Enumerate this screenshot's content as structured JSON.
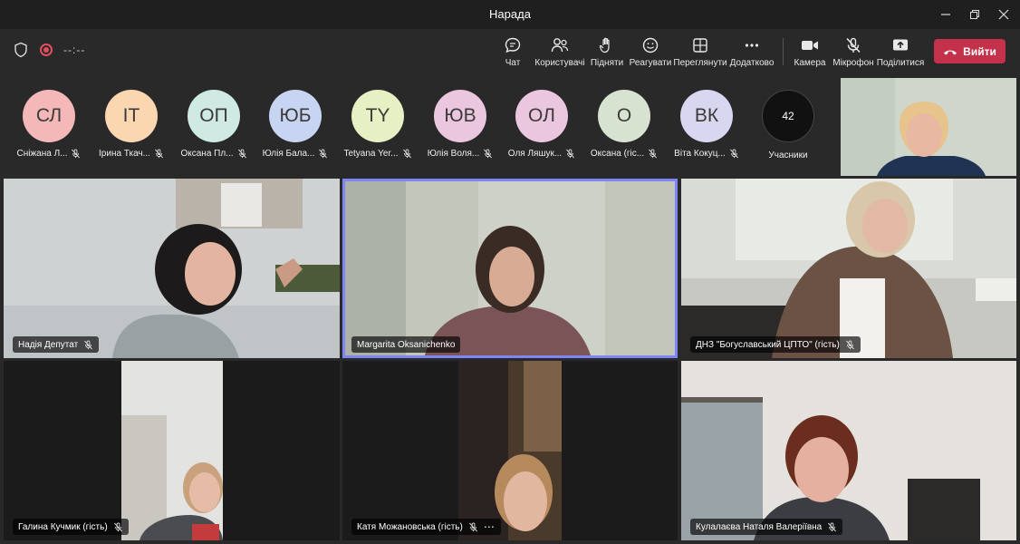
{
  "window": {
    "title": "Нарада"
  },
  "toolbar": {
    "timer": "--:--",
    "buttons": {
      "chat": "Чат",
      "people": "Користувачі",
      "raise": "Підняти",
      "react": "Реагувати",
      "view": "Переглянути",
      "more": "Додатково",
      "camera": "Камера",
      "mic": "Мікрофон",
      "share": "Поділитися"
    },
    "leave": "Вийти",
    "leave_color": "#c4314b"
  },
  "strip": {
    "participants": [
      {
        "initials": "СЛ",
        "name": "Сніжана Л...",
        "color": "#f5b8b8"
      },
      {
        "initials": "ІТ",
        "name": "Ірина Ткач...",
        "color": "#fad7b1"
      },
      {
        "initials": "ОП",
        "name": "Оксана Пл...",
        "color": "#cfe9e3"
      },
      {
        "initials": "ЮБ",
        "name": "Юлія Бала...",
        "color": "#c7d5f2"
      },
      {
        "initials": "TY",
        "name": "Tetyana Yer...",
        "color": "#e6f0c4"
      },
      {
        "initials": "ЮВ",
        "name": "Юлія Воля...",
        "color": "#eac7de"
      },
      {
        "initials": "ОЛ",
        "name": "Оля Ляшук...",
        "color": "#eac7de"
      },
      {
        "initials": "О",
        "name": "Оксана (гіс...",
        "color": "#d7e3d0"
      },
      {
        "initials": "ВК",
        "name": "Віта Кокуц...",
        "color": "#d9d7f0"
      }
    ],
    "count": "42",
    "count_label": "Учасники"
  },
  "tiles": [
    {
      "name": "Надія Депутат",
      "more": false
    },
    {
      "name": "Margarita Oksanichenko",
      "more": false
    },
    {
      "name": "ДНЗ \"Богуславський ЦПТО\" (гість)",
      "more": false
    },
    {
      "name": "Галина Кучмик (гість)",
      "more": false
    },
    {
      "name": "Катя Можановська (гість)",
      "more": true
    },
    {
      "name": "Кулалаєва Наталя Валеріївна",
      "more": false
    }
  ]
}
